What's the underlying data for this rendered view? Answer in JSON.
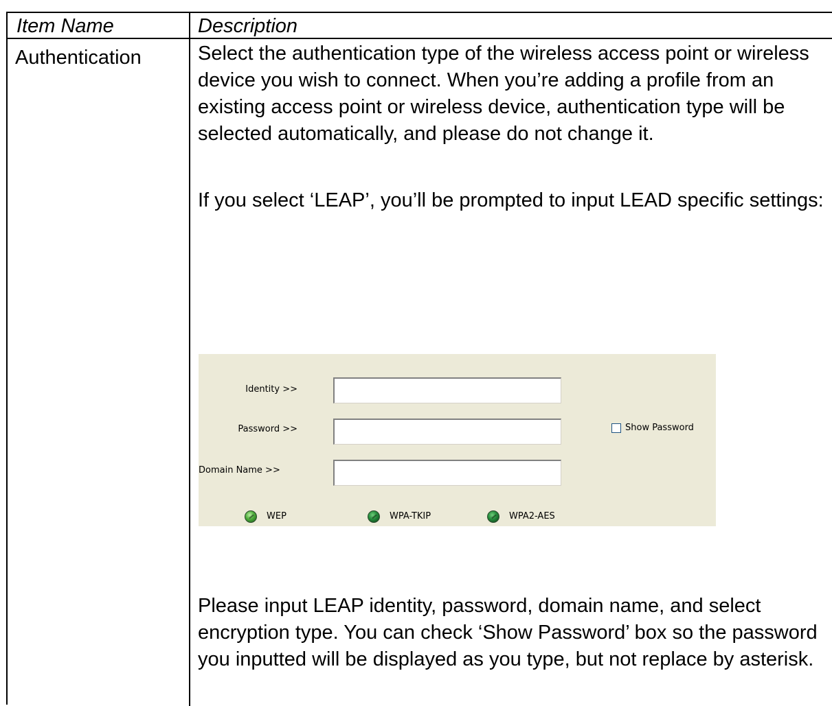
{
  "table": {
    "headers": {
      "item_name": "Item Name",
      "description": "Description"
    },
    "rows": [
      {
        "item_name": "Authentication",
        "description_p1": "Select the authentication type of the wireless access point or wireless device you wish to connect. When you’re adding a profile from an existing access point or wireless device, authentication type will be selected automatically, and please do not change it.",
        "description_p2": "If you select ‘LEAP’, you’ll be prompted to input LEAD specific settings:",
        "description_p3": "Please input LEAP identity, password, domain name, and select encryption type. You can check ‘Show Password’ box so the password you inputted will be displayed as you type, but not replace by asterisk."
      }
    ]
  },
  "leap_settings": {
    "identity_label": "Identity >>",
    "identity_value": "",
    "password_label": "Password >>",
    "password_value": "",
    "domain_label": "Domain Name >>",
    "domain_value": "",
    "show_password_label": "Show Password",
    "show_password_checked": false,
    "encryption_options": [
      "WEP",
      "WPA-TKIP",
      "WPA2-AES"
    ],
    "panel_color": "#ecead8",
    "radio_color": "#2e8b3a"
  }
}
